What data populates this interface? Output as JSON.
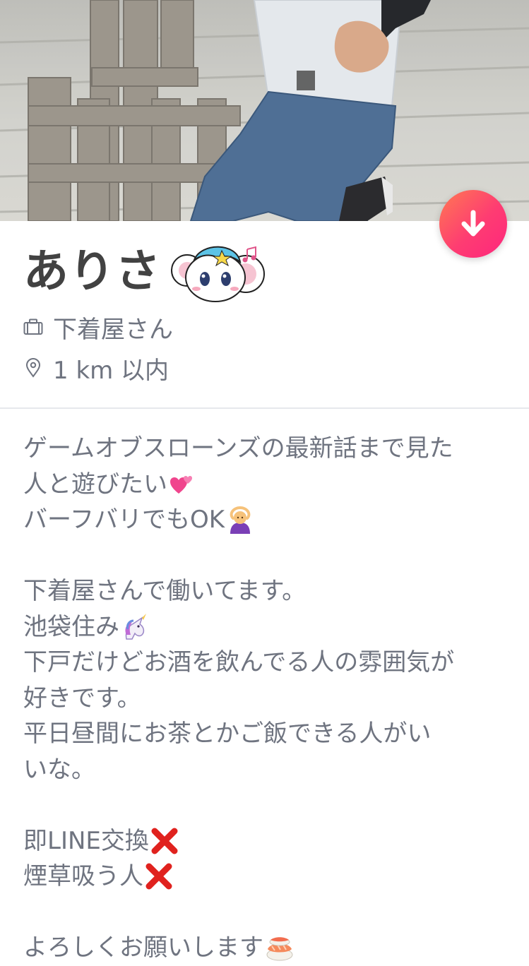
{
  "profile": {
    "name": "ありさ",
    "job": "下着屋さん",
    "distance": "1 km 以内"
  },
  "icons": {
    "rewind": "arrow-down-icon",
    "job": "briefcase-icon",
    "distance": "location-pin-icon",
    "sticker": "cartoon-mouse-sticker"
  },
  "colors": {
    "accent_start": "#ff7a52",
    "accent_end": "#fd267d",
    "name": "#424242",
    "text": "#6f7480",
    "divider": "#e6e8ec"
  },
  "bio": {
    "l1": "ゲームオブスローンズの最新話まで見た",
    "l2": "人と遊びたい",
    "l3": "バーフバリでもOK",
    "l4": "下着屋さんで働いてます。",
    "l5": "池袋住み",
    "l6": "下戸だけどお酒を飲んでる人の雰囲気が",
    "l7": "好きです。",
    "l8": "平日昼間にお茶とかご飯できる人がい",
    "l9": "いな。",
    "l10": "即LINE交換",
    "l11": "煙草吸う人",
    "l12": "よろしくお願いします"
  }
}
